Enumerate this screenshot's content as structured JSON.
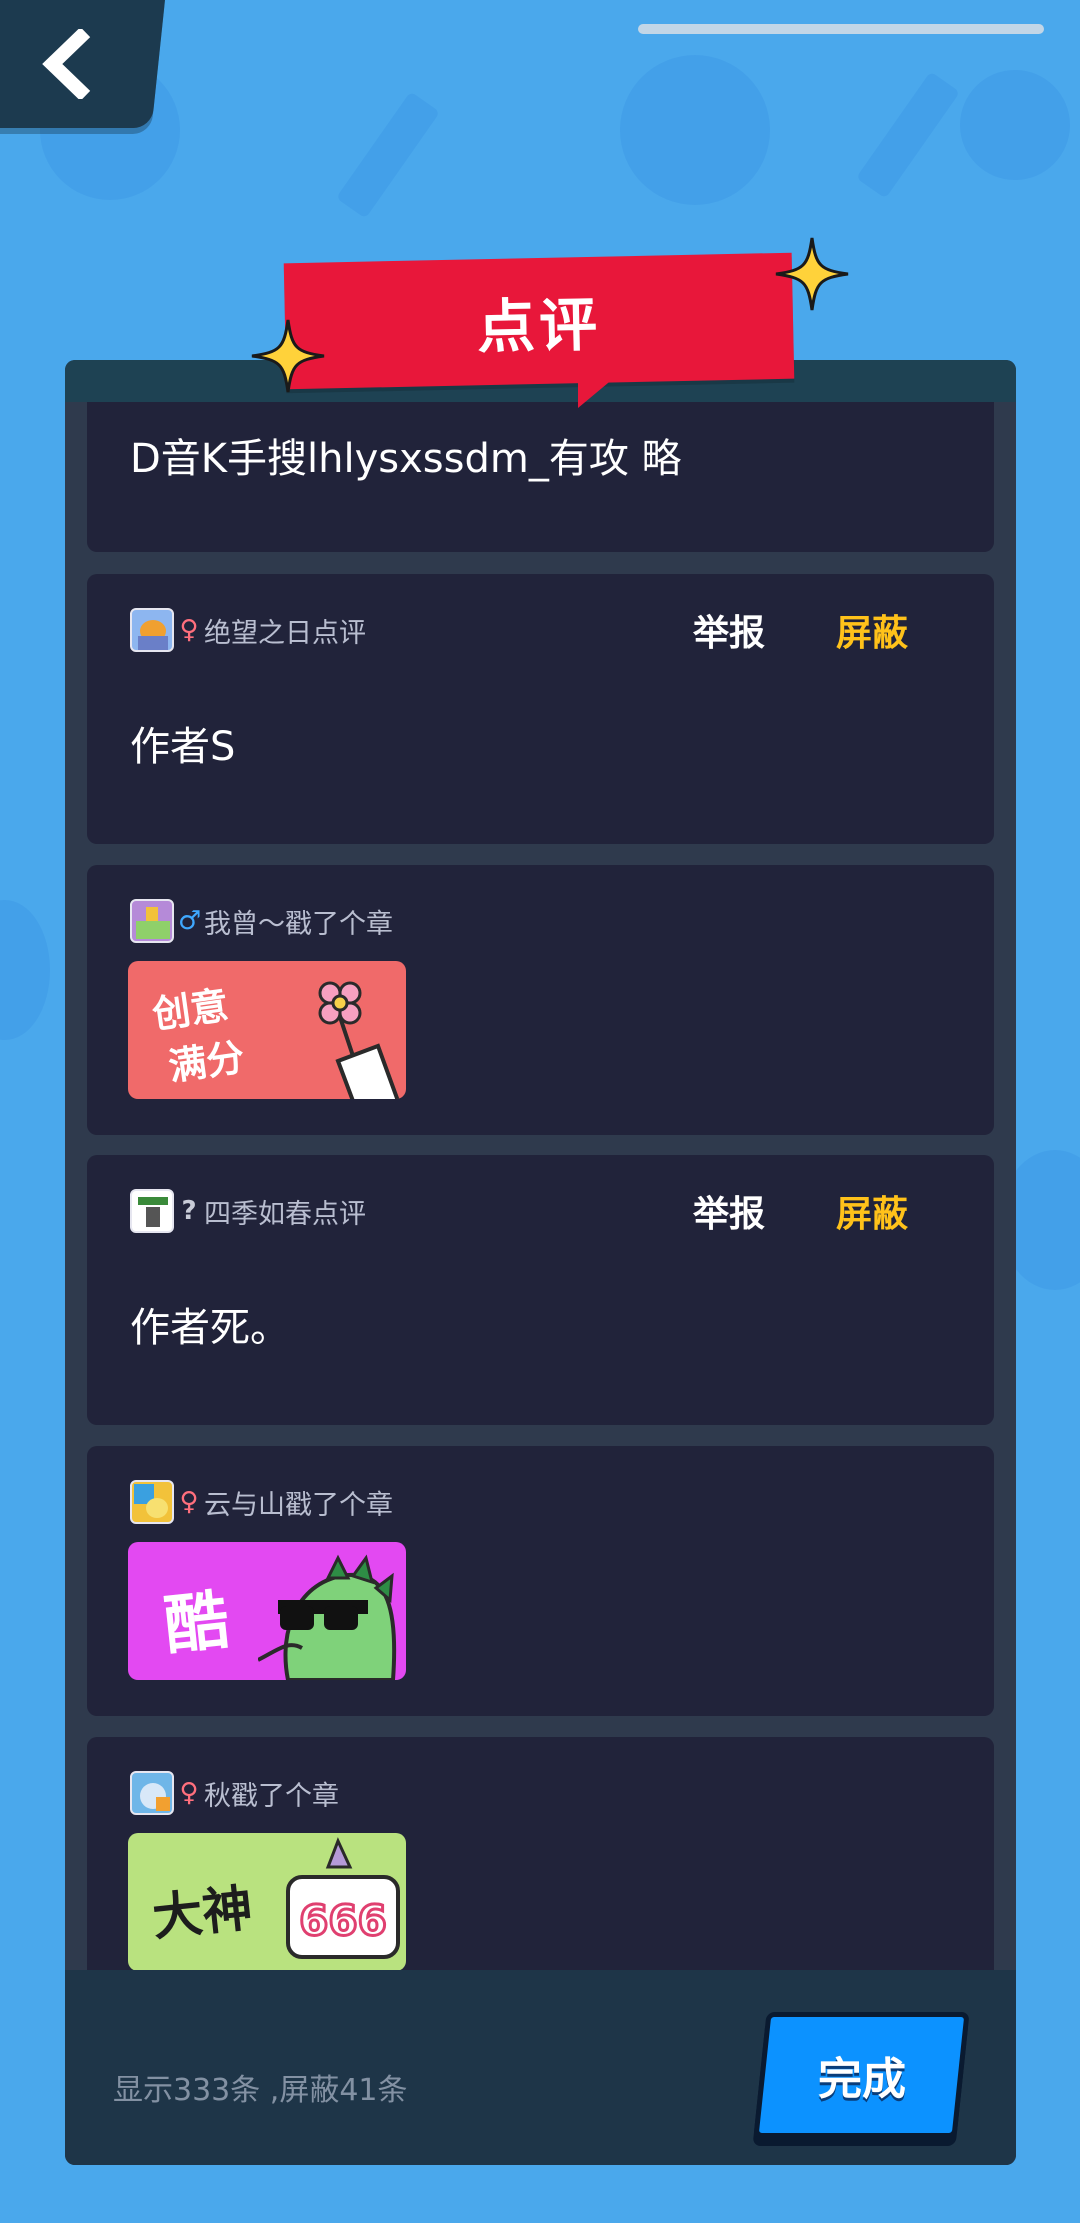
{
  "header": {
    "back_icon": "chevron-left-icon",
    "title": "点评"
  },
  "comments": [
    {
      "type": "text",
      "content": "D音K手搜lhlysxssdm_有攻 略"
    },
    {
      "type": "text",
      "author": "绝望之日点评",
      "gender": "♀",
      "report_label": "举报",
      "block_label": "屏蔽",
      "content": "作者S"
    },
    {
      "type": "sticker",
      "author": "我曾～戳了个章",
      "gender": "♂",
      "sticker_text_1": "创意",
      "sticker_text_2": "满分",
      "sticker_color": "#f06a6a"
    },
    {
      "type": "text",
      "author": "四季如春点评",
      "gender": "?",
      "report_label": "举报",
      "block_label": "屏蔽",
      "content": "作者死。"
    },
    {
      "type": "sticker",
      "author": "云与山戳了个章",
      "gender": "♀",
      "sticker_text_1": "酷",
      "sticker_color": "#e349f2"
    },
    {
      "type": "sticker",
      "author": "秋戳了个章",
      "gender": "♀",
      "sticker_text_1": "大神",
      "sticker_text_2": "666",
      "sticker_color": "#b9e27f"
    }
  ],
  "footer": {
    "summary": "显示333条 ,屏蔽41条",
    "done_label": "完成"
  },
  "colors": {
    "background": "#4aa8ec",
    "panel": "#2f3a4d",
    "card": "#21233a",
    "ribbon": "#e8173a",
    "block_text": "#ffc21a",
    "done_button": "#0c92ff"
  }
}
